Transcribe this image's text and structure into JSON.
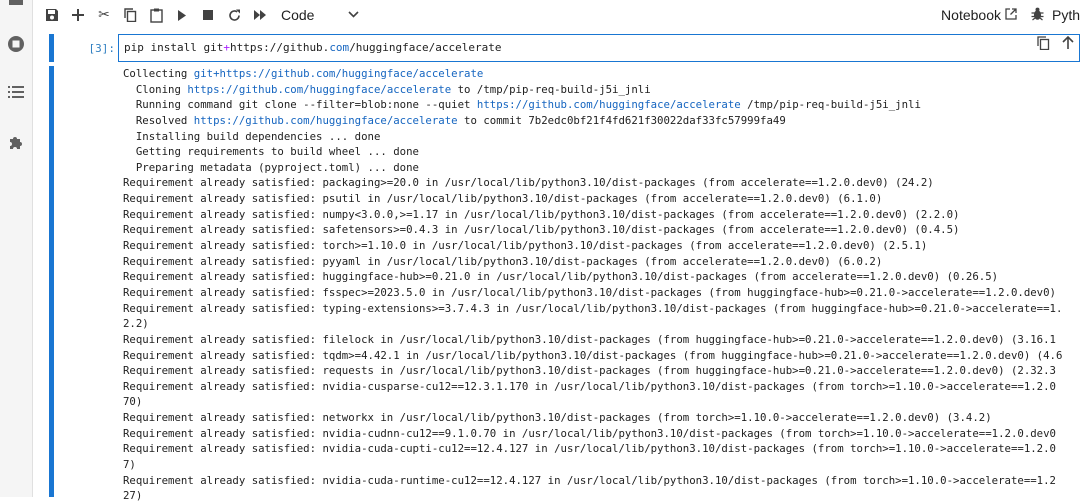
{
  "toolbar": {
    "cell_type": "Code",
    "notebook_label": "Notebook",
    "kernel_label": "Pyth"
  },
  "cell": {
    "prompt": "[3]:",
    "source_parts": [
      "pip install git",
      "+",
      "https://github.",
      "com",
      "/huggingface/accelerate"
    ]
  },
  "output": {
    "lines": [
      {
        "parts": [
          {
            "t": "Collecting "
          },
          {
            "t": "git+https://github.com/huggingface/accelerate",
            "u": 1
          }
        ]
      },
      {
        "parts": [
          {
            "t": "  Cloning "
          },
          {
            "t": "https://github.com/huggingface/accelerate",
            "u": 1
          },
          {
            "t": " to /tmp/pip-req-build-j5i_jnli"
          }
        ]
      },
      {
        "parts": [
          {
            "t": "  Running command git clone --filter=blob:none --quiet "
          },
          {
            "t": "https://github.com/huggingface/accelerate",
            "u": 1
          },
          {
            "t": " /tmp/pip-req-build-j5i_jnli"
          }
        ]
      },
      {
        "parts": [
          {
            "t": "  Resolved "
          },
          {
            "t": "https://github.com/huggingface/accelerate",
            "u": 1
          },
          {
            "t": " to commit 7b2edc0bf21f4fd621f30022daf33fc57999fa49"
          }
        ]
      },
      {
        "parts": [
          {
            "t": "  Installing build dependencies ... done"
          }
        ]
      },
      {
        "parts": [
          {
            "t": "  Getting requirements to build wheel ... done"
          }
        ]
      },
      {
        "parts": [
          {
            "t": "  Preparing metadata (pyproject.toml) ... done"
          }
        ]
      },
      {
        "parts": [
          {
            "t": "Requirement already satisfied: packaging>=20.0 in /usr/local/lib/python3.10/dist-packages (from accelerate==1.2.0.dev0) (24.2)"
          }
        ]
      },
      {
        "parts": [
          {
            "t": "Requirement already satisfied: psutil in /usr/local/lib/python3.10/dist-packages (from accelerate==1.2.0.dev0) (6.1.0)"
          }
        ]
      },
      {
        "parts": [
          {
            "t": "Requirement already satisfied: numpy<3.0.0,>=1.17 in /usr/local/lib/python3.10/dist-packages (from accelerate==1.2.0.dev0) (2.2.0)"
          }
        ]
      },
      {
        "parts": [
          {
            "t": "Requirement already satisfied: safetensors>=0.4.3 in /usr/local/lib/python3.10/dist-packages (from accelerate==1.2.0.dev0) (0.4.5)"
          }
        ]
      },
      {
        "parts": [
          {
            "t": "Requirement already satisfied: torch>=1.10.0 in /usr/local/lib/python3.10/dist-packages (from accelerate==1.2.0.dev0) (2.5.1)"
          }
        ]
      },
      {
        "parts": [
          {
            "t": "Requirement already satisfied: pyyaml in /usr/local/lib/python3.10/dist-packages (from accelerate==1.2.0.dev0) (6.0.2)"
          }
        ]
      },
      {
        "parts": [
          {
            "t": "Requirement already satisfied: huggingface-hub>=0.21.0 in /usr/local/lib/python3.10/dist-packages (from accelerate==1.2.0.dev0) (0.26.5)"
          }
        ]
      },
      {
        "parts": [
          {
            "t": "Requirement already satisfied: fsspec>=2023.5.0 in /usr/local/lib/python3.10/dist-packages (from huggingface-hub>=0.21.0->accelerate==1.2.0.dev0)"
          }
        ]
      },
      {
        "parts": [
          {
            "t": "Requirement already satisfied: typing-extensions>=3.7.4.3 in /usr/local/lib/python3.10/dist-packages (from huggingface-hub>=0.21.0->accelerate==1."
          }
        ]
      },
      {
        "parts": [
          {
            "t": "2.2)"
          }
        ]
      },
      {
        "parts": [
          {
            "t": "Requirement already satisfied: filelock in /usr/local/lib/python3.10/dist-packages (from huggingface-hub>=0.21.0->accelerate==1.2.0.dev0) (3.16.1"
          }
        ]
      },
      {
        "parts": [
          {
            "t": "Requirement already satisfied: tqdm>=4.42.1 in /usr/local/lib/python3.10/dist-packages (from huggingface-hub>=0.21.0->accelerate==1.2.0.dev0) (4.6"
          }
        ]
      },
      {
        "parts": [
          {
            "t": "Requirement already satisfied: requests in /usr/local/lib/python3.10/dist-packages (from huggingface-hub>=0.21.0->accelerate==1.2.0.dev0) (2.32.3"
          }
        ]
      },
      {
        "parts": [
          {
            "t": "Requirement already satisfied: nvidia-cusparse-cu12==12.3.1.170 in /usr/local/lib/python3.10/dist-packages (from torch>=1.10.0->accelerate==1.2.0"
          }
        ]
      },
      {
        "parts": [
          {
            "t": "70)"
          }
        ]
      },
      {
        "parts": [
          {
            "t": "Requirement already satisfied: networkx in /usr/local/lib/python3.10/dist-packages (from torch>=1.10.0->accelerate==1.2.0.dev0) (3.4.2)"
          }
        ]
      },
      {
        "parts": [
          {
            "t": "Requirement already satisfied: nvidia-cudnn-cu12==9.1.0.70 in /usr/local/lib/python3.10/dist-packages (from torch>=1.10.0->accelerate==1.2.0.dev0"
          }
        ]
      },
      {
        "parts": [
          {
            "t": "Requirement already satisfied: nvidia-cuda-cupti-cu12==12.4.127 in /usr/local/lib/python3.10/dist-packages (from torch>=1.10.0->accelerate==1.2.0"
          }
        ]
      },
      {
        "parts": [
          {
            "t": "7)"
          }
        ]
      },
      {
        "parts": [
          {
            "t": "Requirement already satisfied: nvidia-cuda-runtime-cu12==12.4.127 in /usr/local/lib/python3.10/dist-packages (from torch>=1.10.0->accelerate==1.2"
          }
        ]
      },
      {
        "parts": [
          {
            "t": "27)"
          }
        ]
      }
    ]
  }
}
